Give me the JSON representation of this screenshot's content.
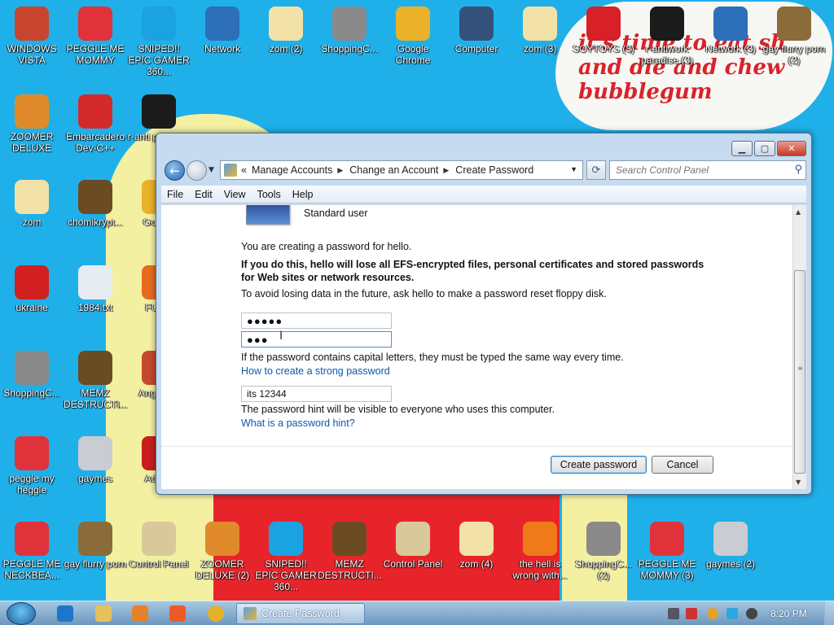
{
  "wallpaper": {
    "sign_text": "it's time to eat sh and die and chew bubblegum"
  },
  "desktop_icons": [
    {
      "label": "WINDOWS VISTA",
      "icon": "vista-orb-icon",
      "color": "#c7452e"
    },
    {
      "label": "PEGGLE ME MOMMY",
      "icon": "peggle-icon",
      "color": "#e0323a"
    },
    {
      "label": "SNIPED!! EPIC GAMER 360...",
      "icon": "skype-icon",
      "color": "#1aa3e0"
    },
    {
      "label": "Network",
      "icon": "network-globe-icon",
      "color": "#2d6fb8"
    },
    {
      "label": "zom (2)",
      "icon": "flower-icon",
      "color": "#f2e2a8"
    },
    {
      "label": "ShoppingC...",
      "icon": "flash-icon",
      "color": "#8a8a8a"
    },
    {
      "label": "Google Chrome",
      "icon": "chrome-icon",
      "color": "#e9b229"
    },
    {
      "label": "Computer",
      "icon": "computer-icon",
      "color": "#34517b"
    },
    {
      "label": "zom (3)",
      "icon": "flower-icon",
      "color": "#f2e2a8"
    },
    {
      "label": "SOYTOYS (3)",
      "icon": "skype-icon",
      "color": "#d72027"
    },
    {
      "label": "r-antiwork paradise (3)",
      "icon": "antiwork-icon",
      "color": "#1b1b1b"
    },
    {
      "label": "Network (3)",
      "icon": "network-globe-icon",
      "color": "#2d6fb8"
    },
    {
      "label": "gay flurry porn (2)",
      "icon": "box-icon",
      "color": "#8a6b3a"
    },
    {
      "label": "ZOOMER DELUXE",
      "icon": "zoomer-icon",
      "color": "#e08a2b"
    },
    {
      "label": "Embarcadero Dev-C++",
      "icon": "devcpp-icon",
      "color": "#d22a2a"
    },
    {
      "label": "r-anti paradise",
      "icon": "antiwork-icon",
      "color": "#1b1b1b"
    },
    {
      "label": "zom",
      "icon": "flower-icon",
      "color": "#f2e2a8"
    },
    {
      "label": "chomikrypt...",
      "icon": "clock-app-icon",
      "color": "#6b4b22"
    },
    {
      "label": "Go Chr",
      "icon": "chrome-icon",
      "color": "#e9b229"
    },
    {
      "label": "ukraine",
      "icon": "radiation-icon",
      "color": "#d21f1f"
    },
    {
      "label": "1984.txt",
      "icon": "text-file-icon",
      "color": "#e7ecf2"
    },
    {
      "label": "FURR",
      "icon": "firefox-icon",
      "color": "#e66b1f"
    },
    {
      "label": "ShoppingC...",
      "icon": "flash-icon",
      "color": "#8a8a8a"
    },
    {
      "label": "MEMZ DESTRUCTI...",
      "icon": "clock-app-icon",
      "color": "#6b4b22"
    },
    {
      "label": "Angr Sea",
      "icon": "angry-birds-icon",
      "color": "#c44a2f"
    },
    {
      "label": "peggle my heggle",
      "icon": "peggle-icon",
      "color": "#e0323a"
    },
    {
      "label": "gaymes",
      "icon": "folder-icon",
      "color": "#c9ccd2"
    },
    {
      "label": "Adobe",
      "icon": "adobe-icon",
      "color": "#c81e1e"
    },
    {
      "label": "PEGGLE ME NECKBEA...",
      "icon": "peggle-icon",
      "color": "#e0323a"
    },
    {
      "label": "gay flurry porn",
      "icon": "box-icon",
      "color": "#8a6b3a"
    },
    {
      "label": "Control Panel",
      "icon": "control-panel-icon",
      "color": "#d9c99a"
    },
    {
      "label": "ZOOMER DELUXE (2)",
      "icon": "zoomer-icon",
      "color": "#e08a2b"
    },
    {
      "label": "SNIPED!! EPIC GAMER 360...",
      "icon": "skype-icon",
      "color": "#1aa3e0"
    },
    {
      "label": "MEMZ DESTRUCTI...",
      "icon": "clock-app-icon",
      "color": "#6b4b22"
    },
    {
      "label": "Control Panel",
      "icon": "control-panel-icon",
      "color": "#d9c99a"
    },
    {
      "label": "zom (4)",
      "icon": "flower-icon",
      "color": "#f2e2a8"
    },
    {
      "label": "the hell is wrong with...",
      "icon": "uc-browser-icon",
      "color": "#ef7a1a"
    },
    {
      "label": "ShoppingC... (2)",
      "icon": "flash-icon",
      "color": "#8a8a8a"
    },
    {
      "label": "PEGGLE ME MOMMY (3)",
      "icon": "peggle-icon",
      "color": "#e0323a"
    },
    {
      "label": "gaymes (2)",
      "icon": "folder-icon",
      "color": "#c9ccd2"
    }
  ],
  "window": {
    "address": {
      "overflow": "«",
      "crumbs": [
        "Manage Accounts",
        "Change an Account",
        "Create Password"
      ]
    },
    "search_placeholder": "Search Control Panel",
    "menu": [
      "File",
      "Edit",
      "View",
      "Tools",
      "Help"
    ],
    "content": {
      "user_type": "Standard user",
      "creating": "You are creating a password for hello.",
      "warning": "If you do this, hello will lose all EFS-encrypted files, personal certificates and stored passwords for Web sites or network resources.",
      "avoid": "To avoid losing data in the future, ask hello to make a password reset floppy disk.",
      "new_password_mask": "●●●●●",
      "confirm_password_mask": "●●●",
      "capital_note": "If the password contains capital letters, they must be typed the same way every time.",
      "strong_link": "How to create a strong password",
      "hint_value": "its 12344",
      "hint_note": "The password hint will be visible to everyone who uses this computer.",
      "hint_link": "What is a password hint?",
      "create_button": "Create password",
      "cancel_button": "Cancel"
    }
  },
  "taskbar": {
    "active_task": "Create Password",
    "clock": "8:20 PM"
  }
}
